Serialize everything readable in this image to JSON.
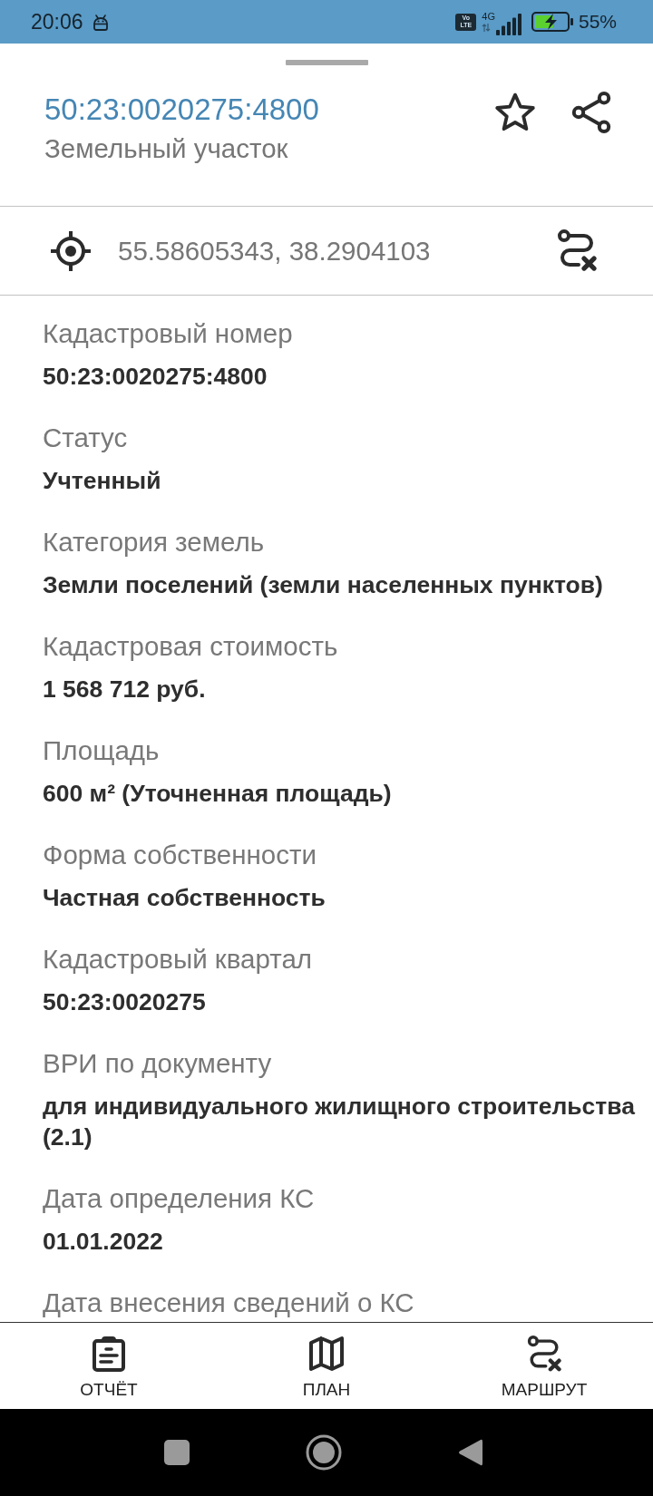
{
  "status_bar": {
    "time": "20:06",
    "volte": "Vo LTE",
    "network": "4G",
    "battery": "55%"
  },
  "sheet": {
    "title": "50:23:0020275:4800",
    "subtitle": "Земельный участок",
    "starred": false
  },
  "location": {
    "coordinates": "55.58605343, 38.2904103"
  },
  "fields": [
    {
      "label": "Кадастровый номер",
      "value": "50:23:0020275:4800"
    },
    {
      "label": "Статус",
      "value": "Учтенный"
    },
    {
      "label": "Категория земель",
      "value": "Земли поселений (земли населенных пунктов)"
    },
    {
      "label": "Кадастровая стоимость",
      "value": "1 568 712 руб."
    },
    {
      "label": "Площадь",
      "value": "600 м² (Уточненная площадь)"
    },
    {
      "label": "Форма собственности",
      "value": "Частная собственность"
    },
    {
      "label": "Кадастровый квартал",
      "value": "50:23:0020275"
    },
    {
      "label": "ВРИ по документу",
      "value": "для индивидуального жилищного строительства (2.1)"
    },
    {
      "label": "Дата определения КС",
      "value": "01.01.2022"
    },
    {
      "label": "Дата внесения сведений о КС"
    }
  ],
  "bottom_nav": [
    {
      "kind": "report",
      "label": "ОТЧЁТ"
    },
    {
      "kind": "plan",
      "label": "ПЛАН"
    },
    {
      "kind": "route",
      "label": "МАРШРУТ"
    }
  ]
}
